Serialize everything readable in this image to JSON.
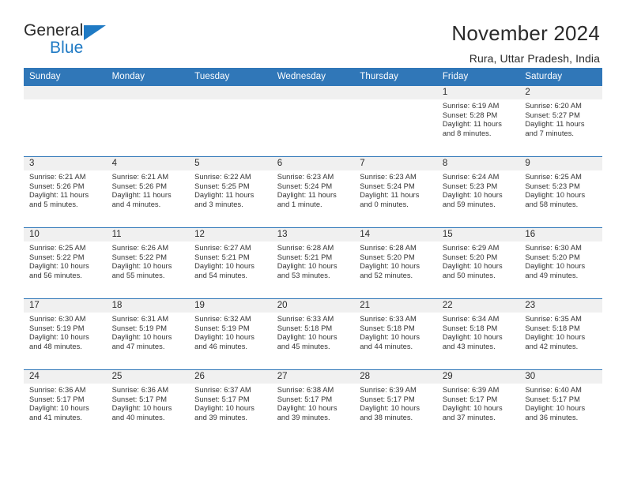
{
  "brand": {
    "name_part1": "General",
    "name_part2": "Blue",
    "triangle_icon": "triangle-icon",
    "accent_color": "#1f7ac4"
  },
  "header": {
    "title": "November 2024",
    "subtitle": "Rura, Uttar Pradesh, India"
  },
  "theme": {
    "header_blue": "#3077b8",
    "band_gray": "#f0f0f0",
    "text": "#2b2b2b"
  },
  "weekdays": [
    "Sunday",
    "Monday",
    "Tuesday",
    "Wednesday",
    "Thursday",
    "Friday",
    "Saturday"
  ],
  "weeks": [
    [
      {
        "day": "",
        "empty": true
      },
      {
        "day": "",
        "empty": true
      },
      {
        "day": "",
        "empty": true
      },
      {
        "day": "",
        "empty": true
      },
      {
        "day": "",
        "empty": true
      },
      {
        "day": "1",
        "sunrise": "Sunrise: 6:19 AM",
        "sunset": "Sunset: 5:28 PM",
        "daylight": "Daylight: 11 hours and 8 minutes."
      },
      {
        "day": "2",
        "sunrise": "Sunrise: 6:20 AM",
        "sunset": "Sunset: 5:27 PM",
        "daylight": "Daylight: 11 hours and 7 minutes."
      }
    ],
    [
      {
        "day": "3",
        "sunrise": "Sunrise: 6:21 AM",
        "sunset": "Sunset: 5:26 PM",
        "daylight": "Daylight: 11 hours and 5 minutes."
      },
      {
        "day": "4",
        "sunrise": "Sunrise: 6:21 AM",
        "sunset": "Sunset: 5:26 PM",
        "daylight": "Daylight: 11 hours and 4 minutes."
      },
      {
        "day": "5",
        "sunrise": "Sunrise: 6:22 AM",
        "sunset": "Sunset: 5:25 PM",
        "daylight": "Daylight: 11 hours and 3 minutes."
      },
      {
        "day": "6",
        "sunrise": "Sunrise: 6:23 AM",
        "sunset": "Sunset: 5:24 PM",
        "daylight": "Daylight: 11 hours and 1 minute."
      },
      {
        "day": "7",
        "sunrise": "Sunrise: 6:23 AM",
        "sunset": "Sunset: 5:24 PM",
        "daylight": "Daylight: 11 hours and 0 minutes."
      },
      {
        "day": "8",
        "sunrise": "Sunrise: 6:24 AM",
        "sunset": "Sunset: 5:23 PM",
        "daylight": "Daylight: 10 hours and 59 minutes."
      },
      {
        "day": "9",
        "sunrise": "Sunrise: 6:25 AM",
        "sunset": "Sunset: 5:23 PM",
        "daylight": "Daylight: 10 hours and 58 minutes."
      }
    ],
    [
      {
        "day": "10",
        "sunrise": "Sunrise: 6:25 AM",
        "sunset": "Sunset: 5:22 PM",
        "daylight": "Daylight: 10 hours and 56 minutes."
      },
      {
        "day": "11",
        "sunrise": "Sunrise: 6:26 AM",
        "sunset": "Sunset: 5:22 PM",
        "daylight": "Daylight: 10 hours and 55 minutes."
      },
      {
        "day": "12",
        "sunrise": "Sunrise: 6:27 AM",
        "sunset": "Sunset: 5:21 PM",
        "daylight": "Daylight: 10 hours and 54 minutes."
      },
      {
        "day": "13",
        "sunrise": "Sunrise: 6:28 AM",
        "sunset": "Sunset: 5:21 PM",
        "daylight": "Daylight: 10 hours and 53 minutes."
      },
      {
        "day": "14",
        "sunrise": "Sunrise: 6:28 AM",
        "sunset": "Sunset: 5:20 PM",
        "daylight": "Daylight: 10 hours and 52 minutes."
      },
      {
        "day": "15",
        "sunrise": "Sunrise: 6:29 AM",
        "sunset": "Sunset: 5:20 PM",
        "daylight": "Daylight: 10 hours and 50 minutes."
      },
      {
        "day": "16",
        "sunrise": "Sunrise: 6:30 AM",
        "sunset": "Sunset: 5:20 PM",
        "daylight": "Daylight: 10 hours and 49 minutes."
      }
    ],
    [
      {
        "day": "17",
        "sunrise": "Sunrise: 6:30 AM",
        "sunset": "Sunset: 5:19 PM",
        "daylight": "Daylight: 10 hours and 48 minutes."
      },
      {
        "day": "18",
        "sunrise": "Sunrise: 6:31 AM",
        "sunset": "Sunset: 5:19 PM",
        "daylight": "Daylight: 10 hours and 47 minutes."
      },
      {
        "day": "19",
        "sunrise": "Sunrise: 6:32 AM",
        "sunset": "Sunset: 5:19 PM",
        "daylight": "Daylight: 10 hours and 46 minutes."
      },
      {
        "day": "20",
        "sunrise": "Sunrise: 6:33 AM",
        "sunset": "Sunset: 5:18 PM",
        "daylight": "Daylight: 10 hours and 45 minutes."
      },
      {
        "day": "21",
        "sunrise": "Sunrise: 6:33 AM",
        "sunset": "Sunset: 5:18 PM",
        "daylight": "Daylight: 10 hours and 44 minutes."
      },
      {
        "day": "22",
        "sunrise": "Sunrise: 6:34 AM",
        "sunset": "Sunset: 5:18 PM",
        "daylight": "Daylight: 10 hours and 43 minutes."
      },
      {
        "day": "23",
        "sunrise": "Sunrise: 6:35 AM",
        "sunset": "Sunset: 5:18 PM",
        "daylight": "Daylight: 10 hours and 42 minutes."
      }
    ],
    [
      {
        "day": "24",
        "sunrise": "Sunrise: 6:36 AM",
        "sunset": "Sunset: 5:17 PM",
        "daylight": "Daylight: 10 hours and 41 minutes."
      },
      {
        "day": "25",
        "sunrise": "Sunrise: 6:36 AM",
        "sunset": "Sunset: 5:17 PM",
        "daylight": "Daylight: 10 hours and 40 minutes."
      },
      {
        "day": "26",
        "sunrise": "Sunrise: 6:37 AM",
        "sunset": "Sunset: 5:17 PM",
        "daylight": "Daylight: 10 hours and 39 minutes."
      },
      {
        "day": "27",
        "sunrise": "Sunrise: 6:38 AM",
        "sunset": "Sunset: 5:17 PM",
        "daylight": "Daylight: 10 hours and 39 minutes."
      },
      {
        "day": "28",
        "sunrise": "Sunrise: 6:39 AM",
        "sunset": "Sunset: 5:17 PM",
        "daylight": "Daylight: 10 hours and 38 minutes."
      },
      {
        "day": "29",
        "sunrise": "Sunrise: 6:39 AM",
        "sunset": "Sunset: 5:17 PM",
        "daylight": "Daylight: 10 hours and 37 minutes."
      },
      {
        "day": "30",
        "sunrise": "Sunrise: 6:40 AM",
        "sunset": "Sunset: 5:17 PM",
        "daylight": "Daylight: 10 hours and 36 minutes."
      }
    ]
  ]
}
